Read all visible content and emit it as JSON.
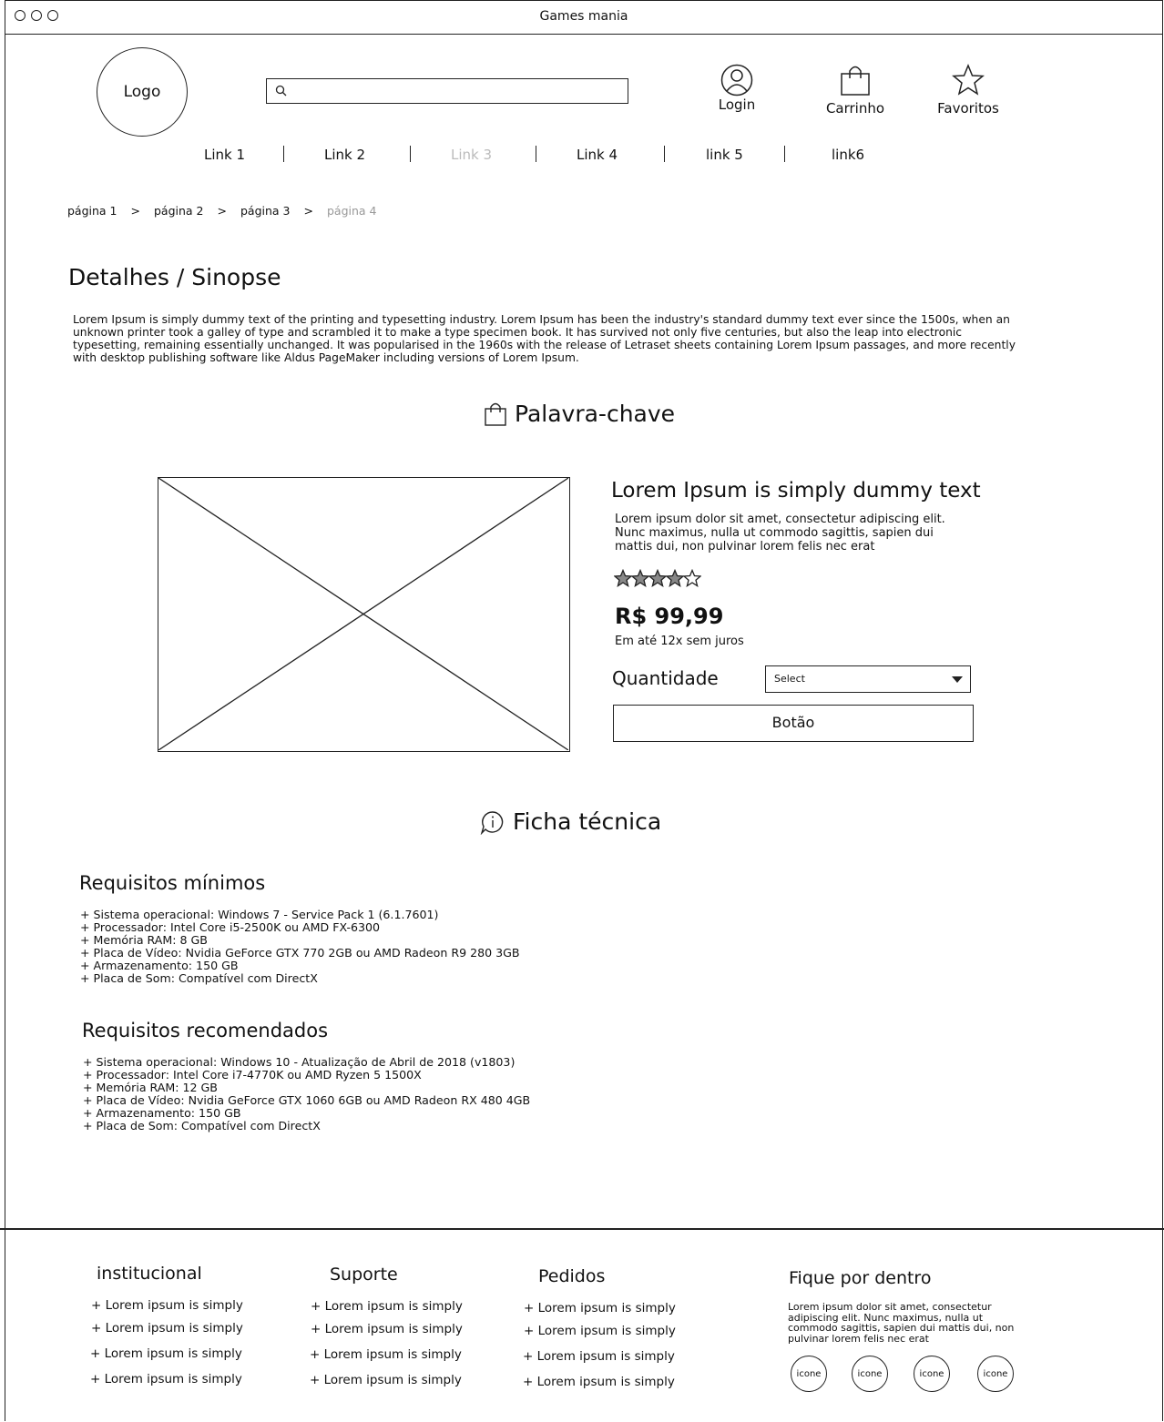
{
  "window": {
    "title": "Games mania"
  },
  "header": {
    "logo": "Logo",
    "search_placeholder": "",
    "login": "Login",
    "cart": "Carrinho",
    "favorites": "Favoritos"
  },
  "nav": [
    "Link 1",
    "Link 2",
    "Link 3",
    "Link 4",
    "link 5",
    "link6"
  ],
  "breadcrumb": {
    "items": [
      "página 1",
      "página 2",
      "página 3",
      "página 4"
    ],
    "separator": ">"
  },
  "details": {
    "title": "Detalhes / Sinopse",
    "text": "Lorem Ipsum is simply dummy text of the printing and typesetting industry. Lorem Ipsum has been the industry's standard dummy text ever since the 1500s, when an unknown printer took a galley of type and scrambled it to make a type specimen book. It has survived not only five centuries, but also the leap into electronic typesetting, remaining essentially unchanged. It was popularised in the 1960s with the release of Letraset sheets containing Lorem Ipsum passages, and more recently with desktop publishing software like Aldus PageMaker including versions of Lorem Ipsum."
  },
  "keyword": {
    "title": "Palavra-chave"
  },
  "product": {
    "title": "Lorem Ipsum is simply dummy text",
    "description": "Lorem ipsum dolor sit amet, consectetur adipiscing elit. Nunc maximus, nulla ut commodo sagittis, sapien dui mattis dui, non pulvinar lorem felis nec erat",
    "rating": 4,
    "rating_max": 5,
    "price": "R$ 99,99",
    "installments": "Em até 12x sem juros",
    "quantity_label": "Quantidade",
    "quantity_select": "Select",
    "button": "Botão"
  },
  "specs": {
    "title": "Ficha técnica",
    "min_title": "Requisitos mínimos",
    "min": [
      "+ Sistema operacional: Windows 7 - Service Pack 1 (6.1.7601)",
      "+ Processador: Intel Core i5-2500K ou AMD FX-6300",
      "+ Memória RAM: 8 GB",
      "+ Placa de Vídeo: Nvidia GeForce GTX 770 2GB ou AMD Radeon R9 280 3GB",
      "+ Armazenamento: 150 GB",
      "+ Placa de Som: Compatível com DirectX"
    ],
    "rec_title": "Requisitos recomendados",
    "rec": [
      "+ Sistema operacional: Windows 10 - Atualização de Abril de 2018 (v1803)",
      "+ Processador: Intel Core i7-4770K ou AMD Ryzen 5 1500X",
      "+ Memória RAM: 12 GB",
      "+ Placa de Vídeo: Nvidia GeForce GTX 1060 6GB ou AMD Radeon RX 480 4GB",
      "+ Armazenamento: 150 GB",
      "+ Placa de Som: Compatível com DirectX"
    ]
  },
  "footer": {
    "columns": [
      {
        "title": "institucional",
        "items": [
          "+ Lorem ipsum is simply",
          "+ Lorem ipsum is simply",
          "+ Lorem ipsum is simply",
          "+ Lorem ipsum is simply"
        ]
      },
      {
        "title": "Suporte",
        "items": [
          "+ Lorem ipsum is simply",
          "+ Lorem ipsum is simply",
          "+ Lorem ipsum is simply",
          "+ Lorem ipsum is simply"
        ]
      },
      {
        "title": "Pedidos",
        "items": [
          "+ Lorem ipsum is simply",
          "+ Lorem ipsum is simply",
          "+ Lorem ipsum is simply",
          "+ Lorem ipsum is simply"
        ]
      }
    ],
    "newsletter": {
      "title": "Fique por dentro",
      "text": "Lorem ipsum dolor sit amet, consectetur adipiscing elit. Nunc maximus, nulla ut commodo sagittis, sapien dui mattis dui, non pulvinar lorem felis nec erat"
    },
    "social": [
      "icone",
      "icone",
      "icone",
      "icone"
    ]
  }
}
